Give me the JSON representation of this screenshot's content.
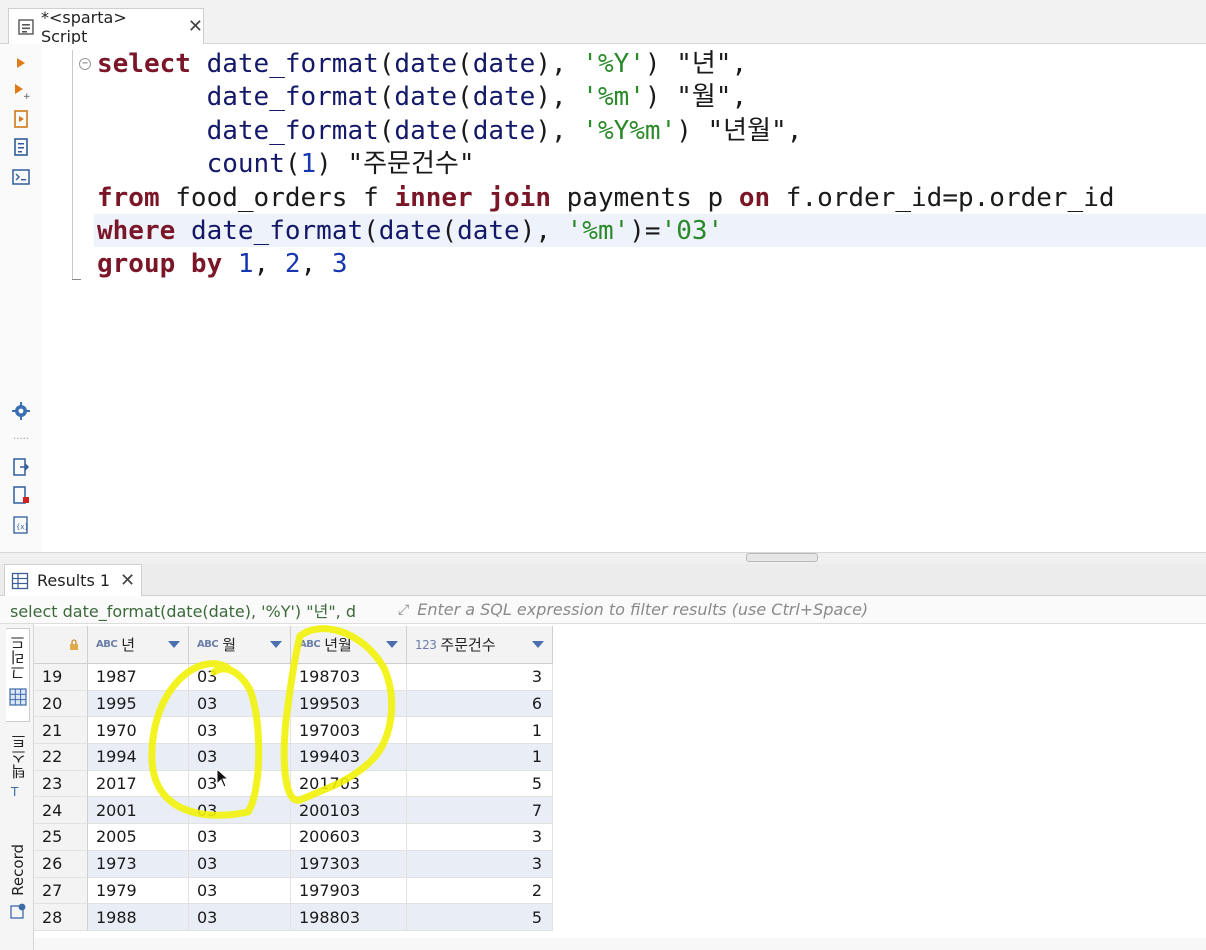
{
  "editor_tab": {
    "label": "*<sparta> Script",
    "close": "✕"
  },
  "code": {
    "line1": {
      "kw": "select",
      "fn": "date_format",
      "a": "(",
      "fn2": "date",
      "b": "(",
      "fn3": "date",
      "c": "), ",
      "str": "'%Y'",
      "d": ") ",
      "alias": "\"년\"",
      "e": ","
    },
    "line2": {
      "fn": "date_format",
      "a": "(",
      "fn2": "date",
      "b": "(",
      "fn3": "date",
      "c": "), ",
      "str": "'%m'",
      "d": ") ",
      "alias": "\"월\"",
      "e": ","
    },
    "line3": {
      "fn": "date_format",
      "a": "(",
      "fn2": "date",
      "b": "(",
      "fn3": "date",
      "c": "), ",
      "str": "'%Y%m'",
      "d": ") ",
      "alias": "\"년월\"",
      "e": ","
    },
    "line4": {
      "fn": "count",
      "a": "(",
      "num": "1",
      "b": ") ",
      "alias": "\"주문건수\""
    },
    "line5": {
      "kw": "from",
      "t1": " food_orders f ",
      "kw2": "inner join",
      "t2": " payments p ",
      "kw3": "on",
      "t3": " f.order_id=p.order_id"
    },
    "line6": {
      "kw": "where",
      "sp": " ",
      "fn": "date_format",
      "a": "(",
      "fn2": "date",
      "b": "(",
      "fn3": "date",
      "c": "), ",
      "str": "'%m'",
      "d": ")=",
      "str2": "'03'"
    },
    "line7": {
      "kw": "group by",
      "sp": " ",
      "n1": "1",
      "c1": ", ",
      "n2": "2",
      "c2": ", ",
      "n3": "3"
    }
  },
  "results_tab": {
    "label": "Results 1",
    "close": "✕"
  },
  "filter": {
    "query": "select date_format(date(date), '%Y') \"년\", d",
    "placeholder": "Enter a SQL expression to filter results (use Ctrl+Space)"
  },
  "side_tabs": {
    "grid": "그리드",
    "text": "텍스트",
    "record": "Record"
  },
  "grid": {
    "columns": [
      {
        "type": "ABC",
        "name": "년"
      },
      {
        "type": "ABC",
        "name": "월"
      },
      {
        "type": "ABC",
        "name": "년월"
      },
      {
        "type": "123",
        "name": "주문건수"
      }
    ],
    "rows": [
      {
        "n": "19",
        "y": "1987",
        "m": "03",
        "ym": "198703",
        "cnt": "3"
      },
      {
        "n": "20",
        "y": "1995",
        "m": "03",
        "ym": "199503",
        "cnt": "6"
      },
      {
        "n": "21",
        "y": "1970",
        "m": "03",
        "ym": "197003",
        "cnt": "1"
      },
      {
        "n": "22",
        "y": "1994",
        "m": "03",
        "ym": "199403",
        "cnt": "1"
      },
      {
        "n": "23",
        "y": "2017",
        "m": "03",
        "ym": "201703",
        "cnt": "5"
      },
      {
        "n": "24",
        "y": "2001",
        "m": "03",
        "ym": "200103",
        "cnt": "7"
      },
      {
        "n": "25",
        "y": "2005",
        "m": "03",
        "ym": "200603",
        "cnt": "3"
      },
      {
        "n": "26",
        "y": "1973",
        "m": "03",
        "ym": "197303",
        "cnt": "3"
      },
      {
        "n": "27",
        "y": "1979",
        "m": "03",
        "ym": "197903",
        "cnt": "2"
      },
      {
        "n": "28",
        "y": "1988",
        "m": "03",
        "ym": "198803",
        "cnt": "5"
      }
    ]
  },
  "colors": {
    "keyword": "#7b1628",
    "function": "#131868",
    "string": "#2a8a2a",
    "number": "#1737b0",
    "highlighter": "#f2f20a",
    "row_alt": "#e9edf6"
  }
}
